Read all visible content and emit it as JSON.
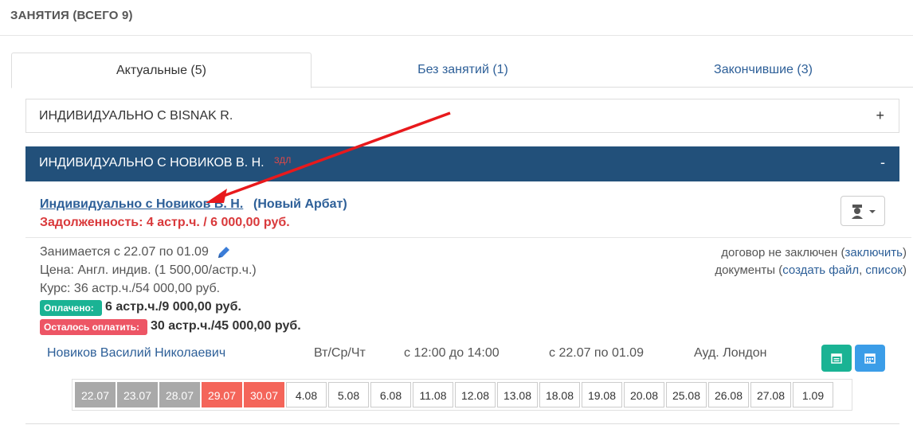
{
  "panel": {
    "title": "ЗАНЯТИЯ (ВСЕГО 9)"
  },
  "tabs": [
    {
      "label": "Актуальные (5)"
    },
    {
      "label": "Без занятий (1)"
    },
    {
      "label": "Закончившие (3)"
    }
  ],
  "groups": [
    {
      "title": "ИНДИВИДУАЛЬНО С BISNAK R.",
      "toggle": "+"
    },
    {
      "title": "ИНДИВИДУАЛЬНО С НОВИКОВ В. Н.",
      "tag": "ЗДЛ",
      "toggle": "-"
    }
  ],
  "lesson": {
    "link": "Индивидуально с Новиков В. Н.",
    "branch": "(Новый Арбат)",
    "debt": "Задолженность: 4 астр.ч. / 6 000,00 руб.",
    "period": "Занимается с 22.07 по 01.09",
    "price": "Цена: Англ. индив. (1 500,00/астр.ч.)",
    "course": "Курс: 36 астр.ч./54 000,00 руб.",
    "paid_label": "Оплачено:",
    "paid_value": "6 астр.ч./9 000,00 руб.",
    "left_label": "Осталось оплатить:",
    "left_value": "30 астр.ч./45 000,00 руб.",
    "contract_text": "договор не заключен (",
    "contract_link": "заключить",
    "contract_close": ")",
    "docs_text": "документы (",
    "docs_create": "создать файл",
    "docs_sep": ", ",
    "docs_list": "список",
    "docs_close": ")"
  },
  "schedule": {
    "teacher": "Новиков Василий Николаевич",
    "days": "Вт/Ср/Чт",
    "time": "с 12:00 до 14:00",
    "range": "с 22.07 по 01.09",
    "room": "Ауд. Лондон"
  },
  "dates": [
    {
      "d": "22.07",
      "status": "gray"
    },
    {
      "d": "23.07",
      "status": "gray"
    },
    {
      "d": "28.07",
      "status": "gray"
    },
    {
      "d": "29.07",
      "status": "red"
    },
    {
      "d": "30.07",
      "status": "red"
    },
    {
      "d": "4.08",
      "status": ""
    },
    {
      "d": "5.08",
      "status": ""
    },
    {
      "d": "6.08",
      "status": ""
    },
    {
      "d": "11.08",
      "status": ""
    },
    {
      "d": "12.08",
      "status": ""
    },
    {
      "d": "13.08",
      "status": ""
    },
    {
      "d": "18.08",
      "status": ""
    },
    {
      "d": "19.08",
      "status": ""
    },
    {
      "d": "20.08",
      "status": ""
    },
    {
      "d": "25.08",
      "status": ""
    },
    {
      "d": "26.08",
      "status": ""
    },
    {
      "d": "27.08",
      "status": ""
    },
    {
      "d": "1.09",
      "status": ""
    }
  ],
  "colors": {
    "accent": "#22507a",
    "link": "#2d5f98",
    "debt": "#d9393b",
    "paid": "#1ab394",
    "unpaid": "#ed5565",
    "annotation": "#e8191c"
  }
}
